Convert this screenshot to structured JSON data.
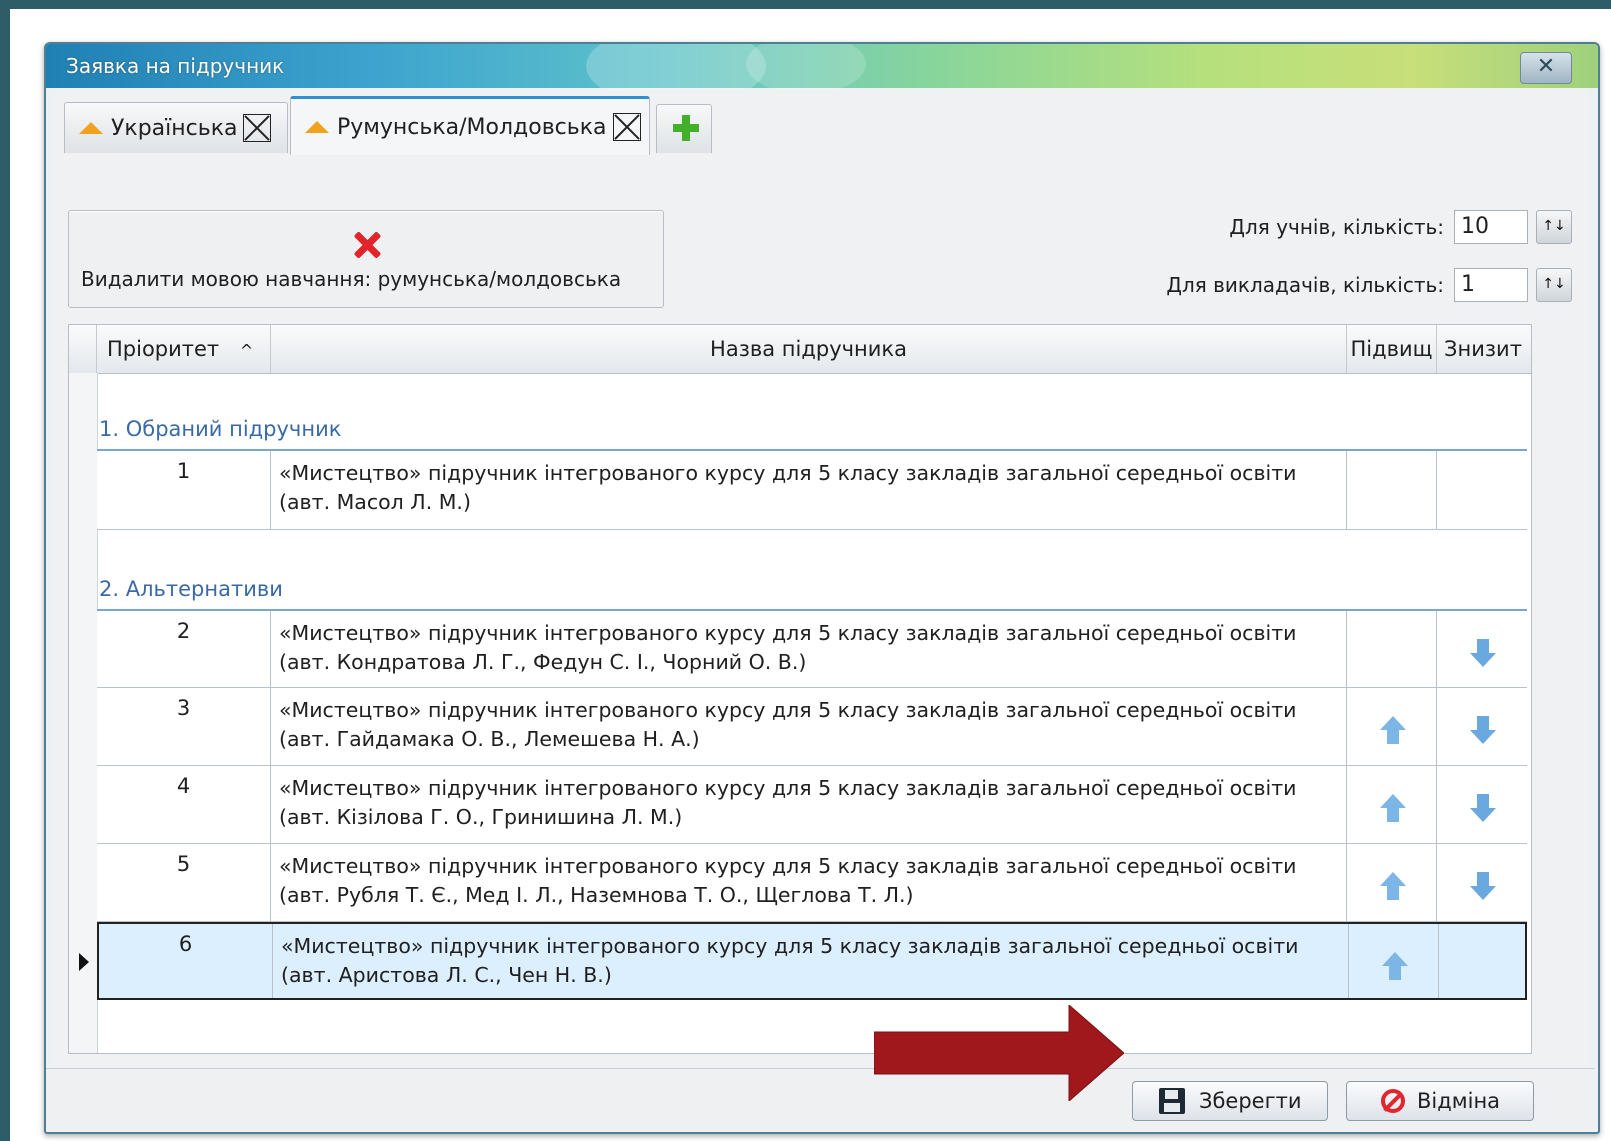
{
  "window": {
    "title": "Заявка на підручник",
    "close_label": "✕"
  },
  "tabs": [
    {
      "label": "Українська"
    },
    {
      "label": "Румунська/Молдовська"
    }
  ],
  "toolbar": {
    "delete_language_label": "Видалити мовою навчання: румунська/молдовська"
  },
  "counts": {
    "students_label": "Для учнів, кількість:",
    "students_value": "10",
    "teachers_label": "Для викладачів, кількість:",
    "teachers_value": "1"
  },
  "grid": {
    "columns": [
      "Пріоритет",
      "Назва підручника",
      "Підвищ",
      "Знизит"
    ],
    "sort_indicator": "^",
    "groups": [
      {
        "label": "1. Обраний підручник"
      },
      {
        "label": "2. Альтернативи"
      }
    ],
    "rows": [
      {
        "priority": "1",
        "title_line1": "«Мистецтво» підручник інтегрованого курсу для 5 класу закладів загальної середньої освіти",
        "title_line2": "(авт. Масол Л. М.)"
      },
      {
        "priority": "2",
        "title_line1": "«Мистецтво» підручник інтегрованого курсу для 5 класу закладів загальної середньої освіти",
        "title_line2": "(авт. Кондратова Л. Г., Федун С. І., Чорний О. В.)"
      },
      {
        "priority": "3",
        "title_line1": "«Мистецтво» підручник інтегрованого курсу для 5 класу закладів загальної середньої освіти",
        "title_line2": "(авт. Гайдамака О. В., Лемешева Н. А.)"
      },
      {
        "priority": "4",
        "title_line1": "«Мистецтво» підручник інтегрованого курсу для 5 класу закладів загальної середньої освіти",
        "title_line2": "(авт. Кізілова Г. О., Гринишина Л. М.)"
      },
      {
        "priority": "5",
        "title_line1": "«Мистецтво» підручник інтегрованого курсу для 5 класу закладів загальної середньої освіти",
        "title_line2": "(авт. Рубля Т. Є., Мед І. Л., Наземнова Т. О., Щеглова Т. Л.)"
      },
      {
        "priority": "6",
        "title_line1": "«Мистецтво» підручник інтегрованого курсу для 5 класу закладів загальної середньої освіти",
        "title_line2": "(авт. Аристова Л. С., Чен Н. В.)"
      }
    ]
  },
  "footer": {
    "save_label": "Зберегти",
    "cancel_label": "Відміна"
  },
  "colors": {
    "title_gradient_start": "#1f80b4",
    "accent": "#2d8fd4",
    "group_text": "#3a6aa6",
    "annotation_arrow": "#a0171c"
  }
}
